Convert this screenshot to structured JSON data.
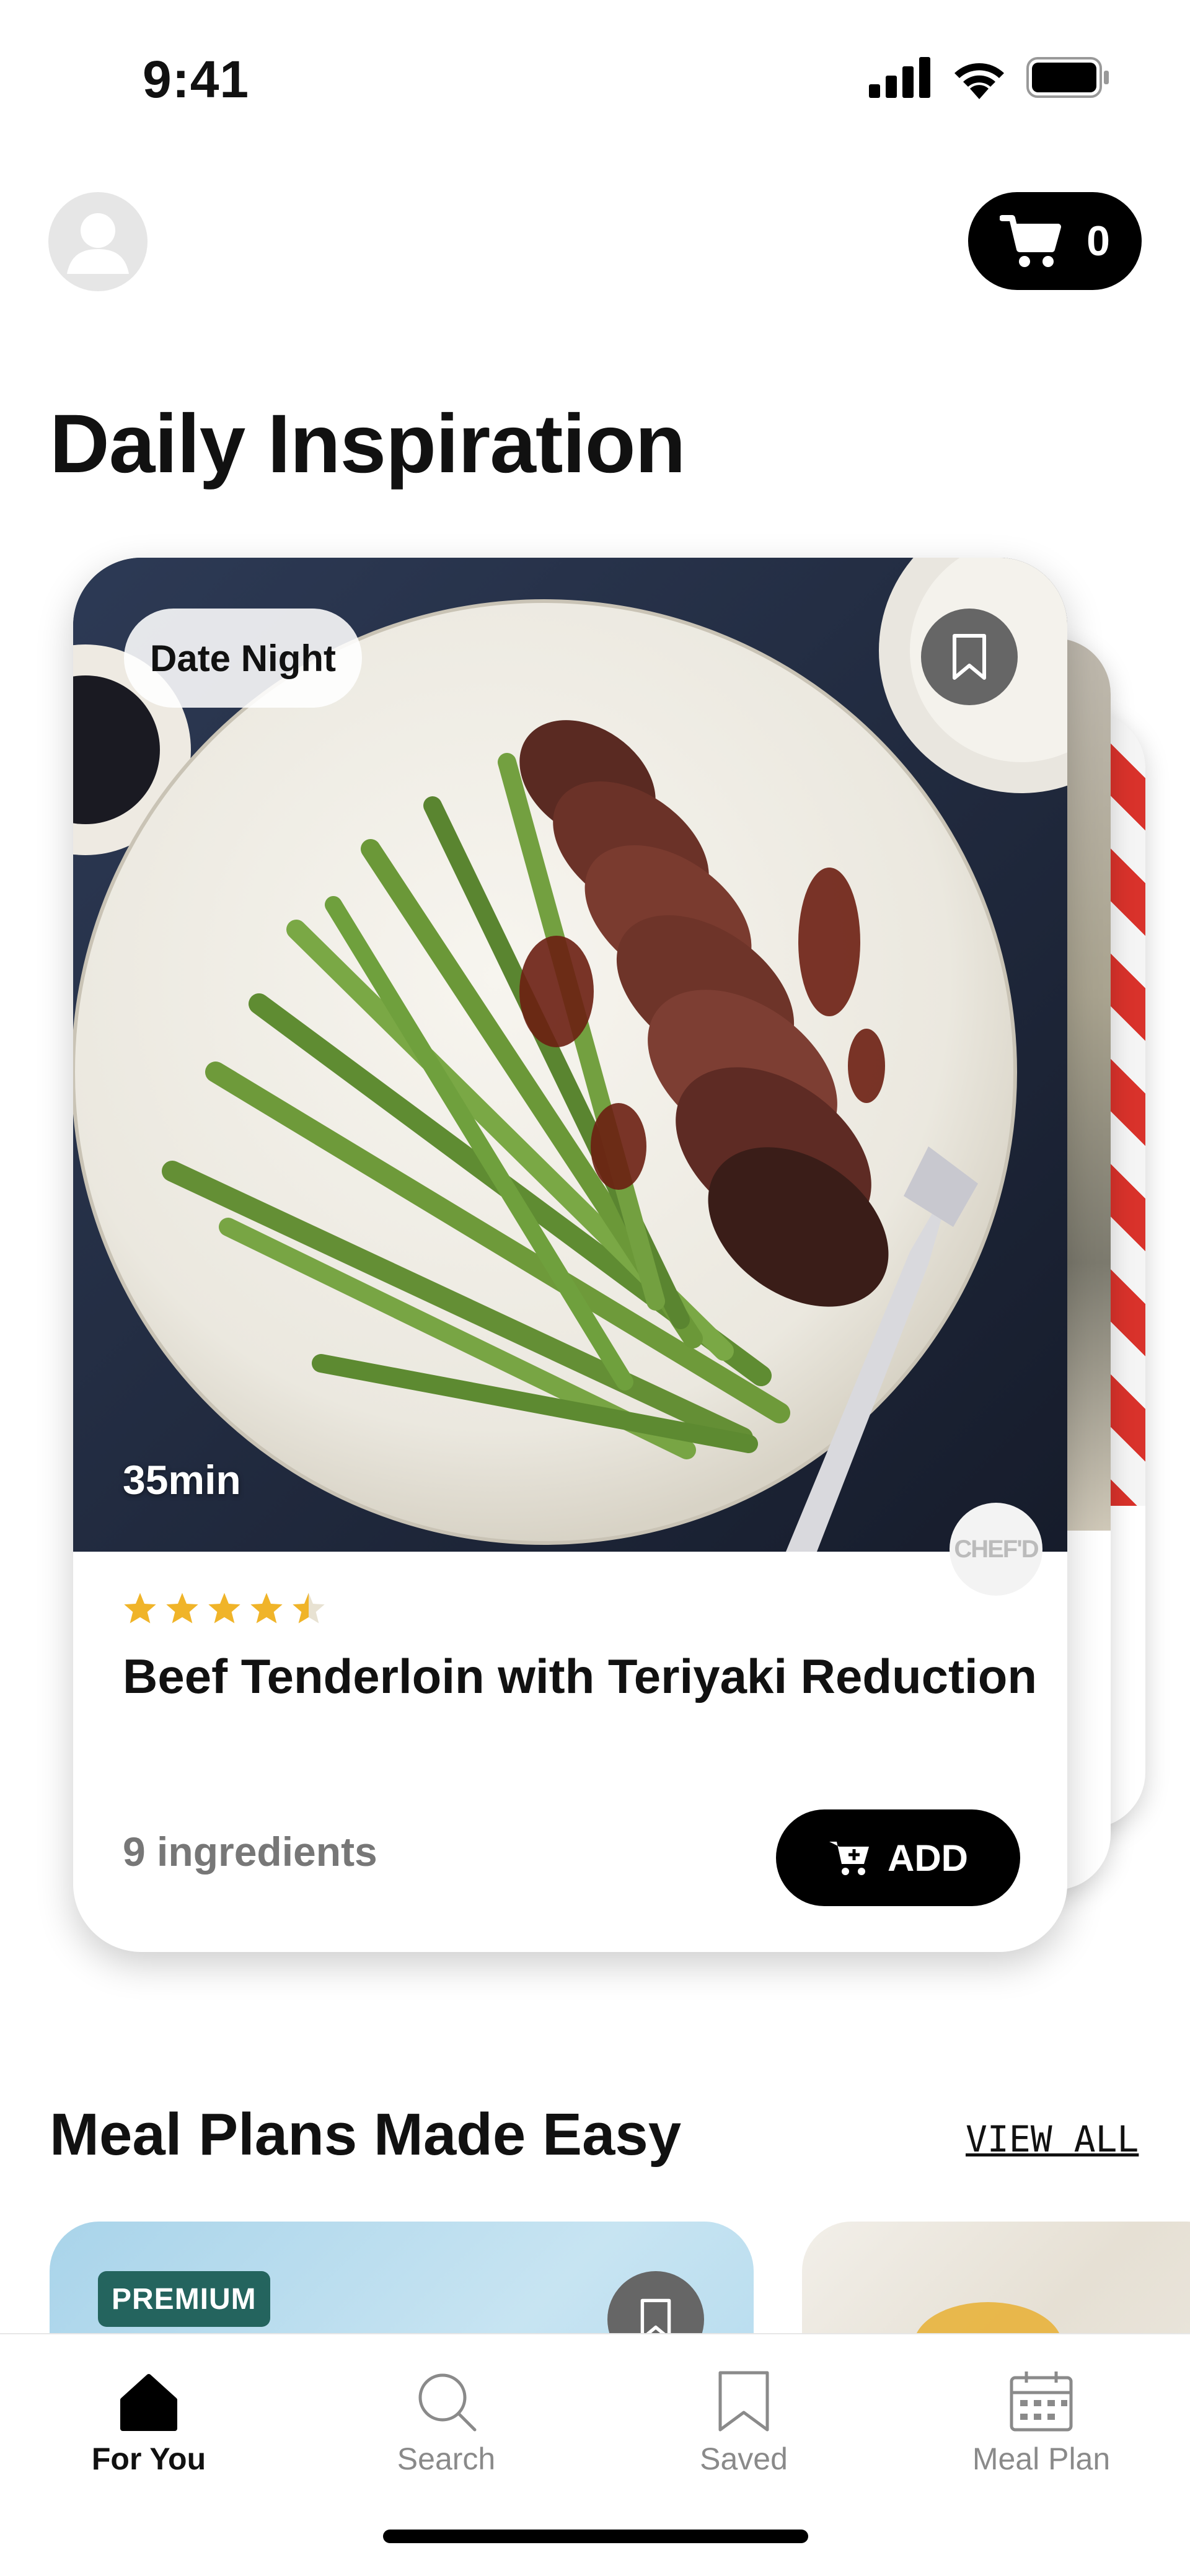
{
  "status_bar": {
    "time": "9:41"
  },
  "header": {
    "cart_count": "0"
  },
  "page_title": "Daily Inspiration",
  "featured_recipe": {
    "tag": "Date Night",
    "duration": "35min",
    "brand_badge": "CHEF'D",
    "rating": 4.5,
    "name": "Beef Tenderloin with Teriyaki Reduction",
    "ingredients": "9 ingredients",
    "add_label": "ADD"
  },
  "meal_plans": {
    "title": "Meal Plans Made Easy",
    "view_all": "VIEW ALL",
    "cards": [
      {
        "badge": "PREMIUM"
      }
    ]
  },
  "tabbar": {
    "tabs": [
      {
        "label": "For You",
        "icon": "home-icon",
        "active": true
      },
      {
        "label": "Search",
        "icon": "search-icon",
        "active": false
      },
      {
        "label": "Saved",
        "icon": "bookmark-icon",
        "active": false
      },
      {
        "label": "Meal Plan",
        "icon": "calendar-icon",
        "active": false
      }
    ]
  },
  "colors": {
    "accent": "#000000",
    "star": "#F0B429",
    "premium": "#24645E",
    "inactive_tab": "#8A8A8A"
  }
}
